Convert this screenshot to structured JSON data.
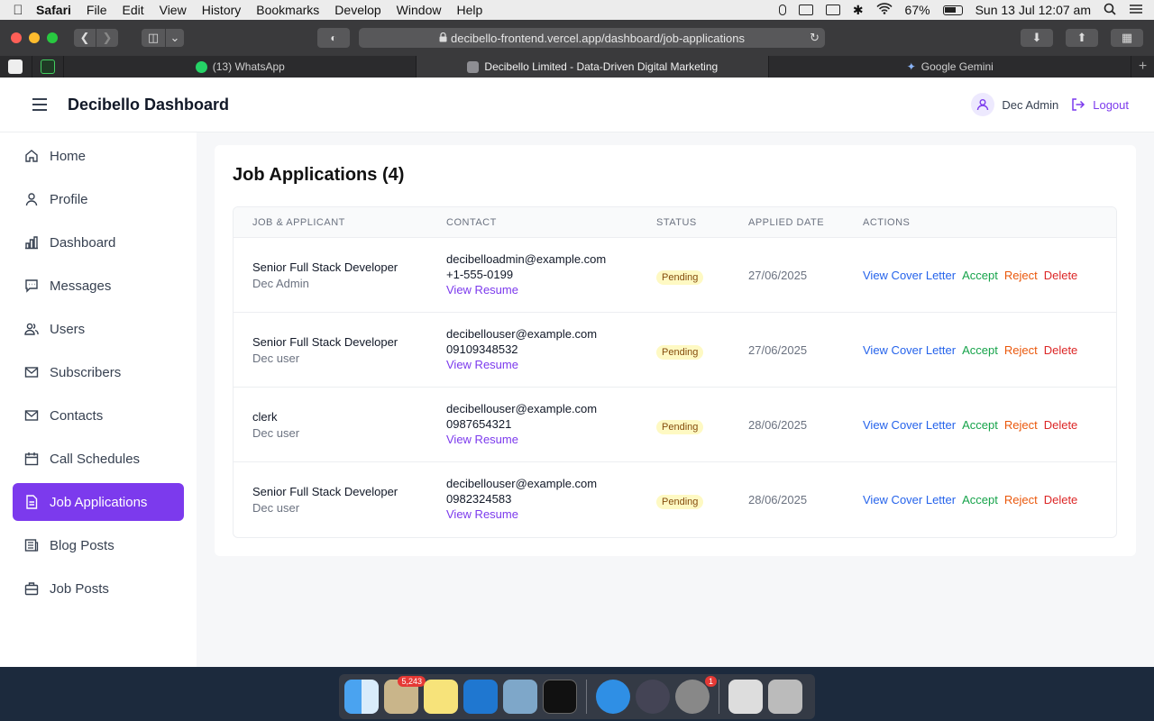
{
  "menubar": {
    "app": "Safari",
    "items": [
      "File",
      "Edit",
      "View",
      "History",
      "Bookmarks",
      "Develop",
      "Window",
      "Help"
    ],
    "battery": "67%",
    "clock": "Sun 13 Jul  12:07 am"
  },
  "browser": {
    "url": "decibello-frontend.vercel.app/dashboard/job-applications",
    "tabs": [
      {
        "label": "(13) WhatsApp",
        "color": "#25d366"
      },
      {
        "label": "Decibello Limited - Data-Driven Digital Marketing",
        "color": "#8e8e93"
      },
      {
        "label": "Google Gemini",
        "color": "#8ab4f8"
      }
    ]
  },
  "header": {
    "title": "Decibello Dashboard",
    "user": "Dec Admin",
    "logout": "Logout"
  },
  "sidebar": {
    "items": [
      {
        "label": "Home",
        "icon": "home-icon"
      },
      {
        "label": "Profile",
        "icon": "user-icon"
      },
      {
        "label": "Dashboard",
        "icon": "bar-chart-icon"
      },
      {
        "label": "Messages",
        "icon": "message-icon"
      },
      {
        "label": "Users",
        "icon": "users-icon"
      },
      {
        "label": "Subscribers",
        "icon": "mail-icon"
      },
      {
        "label": "Contacts",
        "icon": "mail-icon"
      },
      {
        "label": "Call Schedules",
        "icon": "calendar-icon"
      },
      {
        "label": "Job Applications",
        "icon": "document-icon"
      },
      {
        "label": "Blog Posts",
        "icon": "newspaper-icon"
      },
      {
        "label": "Job Posts",
        "icon": "briefcase-icon"
      }
    ],
    "active": "Job Applications"
  },
  "main": {
    "title": "Job Applications (4)",
    "columns": [
      "JOB & APPLICANT",
      "CONTACT",
      "STATUS",
      "APPLIED DATE",
      "ACTIONS"
    ],
    "rows": [
      {
        "job": "Senior Full Stack Developer",
        "applicant": "Dec Admin",
        "email": "decibelloadmin@example.com",
        "phone": "+1-555-0199",
        "resume": "View Resume",
        "status": "Pending",
        "date": "27/06/2025"
      },
      {
        "job": "Senior Full Stack Developer",
        "applicant": "Dec user",
        "email": "decibellouser@example.com",
        "phone": "09109348532",
        "resume": "View Resume",
        "status": "Pending",
        "date": "27/06/2025"
      },
      {
        "job": "clerk",
        "applicant": "Dec user",
        "email": "decibellouser@example.com",
        "phone": "0987654321",
        "resume": "View Resume",
        "status": "Pending",
        "date": "28/06/2025"
      },
      {
        "job": "Senior Full Stack Developer",
        "applicant": "Dec user",
        "email": "decibellouser@example.com",
        "phone": "0982324583",
        "resume": "View Resume",
        "status": "Pending",
        "date": "28/06/2025"
      }
    ],
    "actions": {
      "cover": "View Cover Letter",
      "accept": "Accept",
      "reject": "Reject",
      "delete": "Delete"
    }
  },
  "dock": {
    "badges": {
      "mail": "5,243",
      "settings": "1"
    }
  },
  "colors": {
    "accent": "#7c3aed",
    "pending_bg": "#fef9c3"
  }
}
